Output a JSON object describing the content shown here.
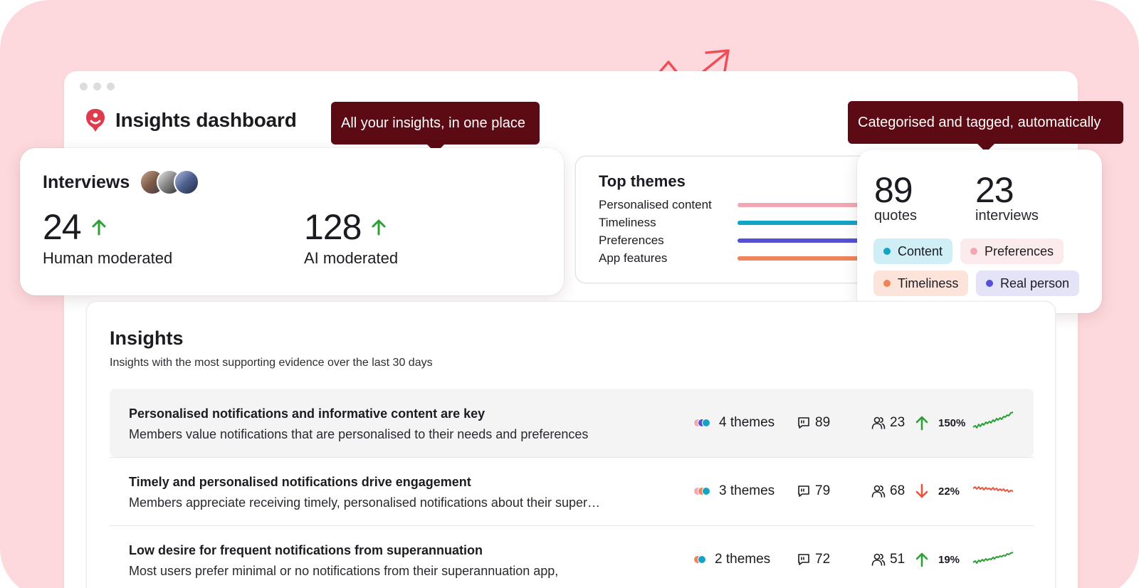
{
  "app": {
    "title": "Insights dashboard"
  },
  "tooltips": {
    "left": "All your insights, in one place",
    "right": "Categorised and tagged, automatically"
  },
  "interviews": {
    "title": "Interviews",
    "human": {
      "value": "24",
      "label": "Human moderated",
      "trend": "up"
    },
    "ai": {
      "value": "128",
      "label": "AI moderated",
      "trend": "up"
    }
  },
  "top_themes": {
    "title": "Top themes",
    "items": [
      {
        "label": "Personalised content",
        "color": "#f2a8b0"
      },
      {
        "label": "Timeliness",
        "color": "#13a3c4"
      },
      {
        "label": "Preferences",
        "color": "#5550d8"
      },
      {
        "label": "App features",
        "color": "#f08357"
      }
    ]
  },
  "counts": {
    "quotes": {
      "value": "89",
      "label": "quotes"
    },
    "interviews": {
      "value": "23",
      "label": "interviews"
    }
  },
  "tags": [
    {
      "label": "Content",
      "dot": "#13a3c4"
    },
    {
      "label": "Preferences",
      "dot": "#f2a8b0"
    },
    {
      "label": "Timeliness",
      "dot": "#f08357"
    },
    {
      "label": "Real person",
      "dot": "#5550d8"
    }
  ],
  "insights": {
    "title": "Insights",
    "subtitle": "Insights with the most supporting evidence over the last 30 days",
    "rows": [
      {
        "title": "Personalised notifications and informative content are key",
        "description": "Members value notifications that are personalised to their needs and preferences",
        "themes": "4 themes",
        "quotes": "89",
        "people": "23",
        "trend": "150%",
        "trend_dir": "up"
      },
      {
        "title": "Timely and personalised notifications drive engagement",
        "description": "Members appreciate receiving timely, personalised notifications about their super…",
        "themes": "3 themes",
        "quotes": "79",
        "people": "68",
        "trend": "22%",
        "trend_dir": "down"
      },
      {
        "title": "Low desire for frequent notifications from superannuation",
        "description": "Most users prefer minimal or no notifications from their superannuation app,",
        "themes": "2 themes",
        "quotes": "72",
        "people": "51",
        "trend": "19%",
        "trend_dir": "up"
      }
    ]
  },
  "colors": {
    "background": "#fdd9dd",
    "tooltip": "#5c0a14",
    "up": "#2aa134",
    "down": "#e8553f",
    "brand": "#e03a4d"
  }
}
